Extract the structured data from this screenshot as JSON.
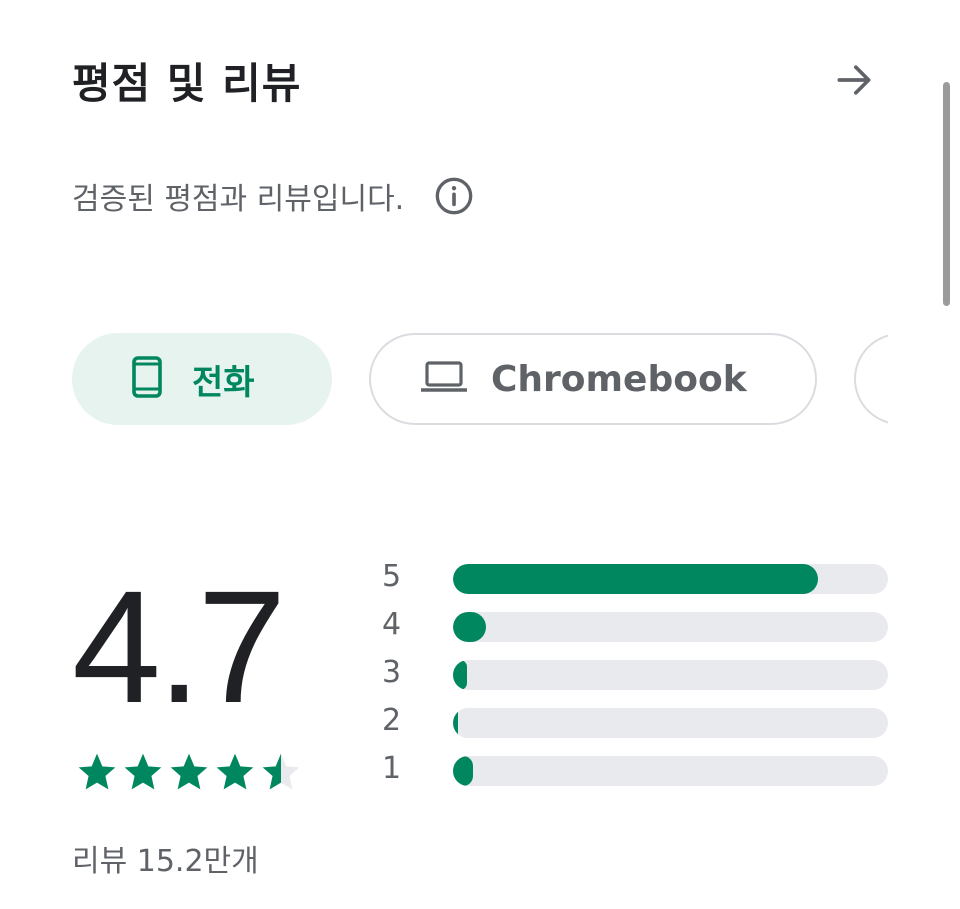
{
  "header": {
    "title": "평점 및 리뷰",
    "arrow_icon": "arrow-right-icon"
  },
  "subtitle": {
    "text": "검증된 평점과 리뷰입니다.",
    "info_icon": "info-icon"
  },
  "device_chips": [
    {
      "label": "전화",
      "icon": "phone-icon",
      "selected": true
    },
    {
      "label": "Chromebook",
      "icon": "laptop-icon",
      "selected": false
    }
  ],
  "rating": {
    "score": "4.7",
    "stars_value": 4.5,
    "review_count": "리뷰 15.2만개",
    "distribution": [
      {
        "star": "5",
        "fraction": 0.84
      },
      {
        "star": "4",
        "fraction": 0.075
      },
      {
        "star": "3",
        "fraction": 0.032
      },
      {
        "star": "2",
        "fraction": 0.012
      },
      {
        "star": "1",
        "fraction": 0.045
      }
    ]
  },
  "colors": {
    "accent": "#01875f",
    "chip_selected_bg": "#e6f3ef",
    "track": "#e8eaed",
    "secondary_text": "#5f6368"
  }
}
